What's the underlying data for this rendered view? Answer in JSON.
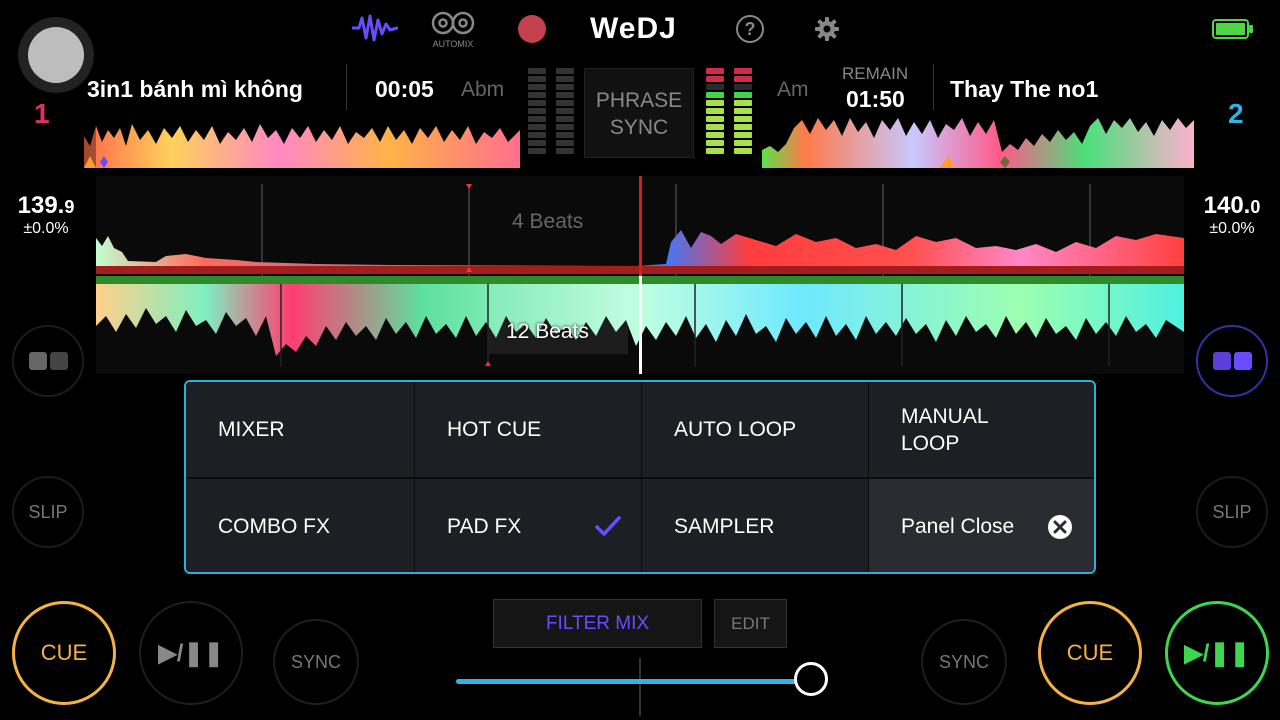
{
  "app": {
    "title": "WeDJ",
    "automix_label": "AUTOMIX"
  },
  "colors": {
    "accent": "#6a4cff",
    "deck1": "#e0306a",
    "deck2": "#2fb4e6",
    "panel_border": "#28b2d9",
    "cue": "#f5b242",
    "play": "#3ed64f"
  },
  "deck1": {
    "number": "1",
    "title": "3in1 bánh mì không",
    "time": "00:05",
    "key": "Abm",
    "bpm": "139.9",
    "bpm_int": "139.",
    "bpm_dec": "9",
    "pitch": "±0.0%",
    "slip_label": "SLIP",
    "cue_label": "CUE",
    "play_label": "▶/❚❚",
    "sync_label": "SYNC"
  },
  "deck2": {
    "number": "2",
    "title": "Thay The no1",
    "remain_label": "REMAIN",
    "time": "01:50",
    "key": "Am",
    "bpm_int": "140.",
    "bpm_dec": "0",
    "pitch": "±0.0%",
    "slip_label": "SLIP",
    "cue_label": "CUE",
    "play_label": "▶/❚❚",
    "sync_label": "SYNC"
  },
  "phrase_sync": {
    "line1": "PHRASE",
    "line2": "SYNC"
  },
  "waveform": {
    "top_label": "4 Beats",
    "bottom_label": "12 Beats"
  },
  "panel": {
    "row1": [
      "MIXER",
      "HOT CUE",
      "AUTO LOOP",
      "MANUAL LOOP"
    ],
    "manual_line1": "MANUAL",
    "manual_line2": "LOOP",
    "row2": [
      "COMBO FX",
      "PAD FX",
      "SAMPLER"
    ],
    "close_label": "Panel Close",
    "selected": "PAD FX"
  },
  "mixer": {
    "filter_mix_label": "FILTER MIX",
    "edit_label": "EDIT",
    "crossfader_value": 0.97
  }
}
